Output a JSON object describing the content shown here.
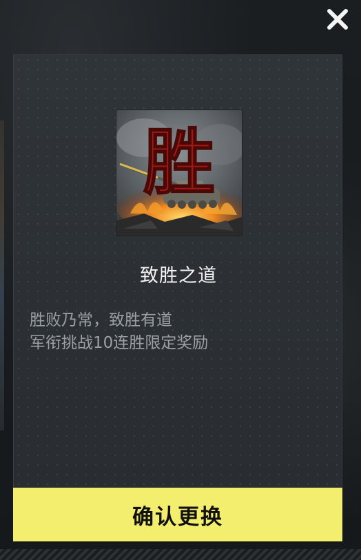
{
  "dialog": {
    "close_icon": "close-icon",
    "reward_icon": "victory-tank-badge-icon",
    "reward_glyph": "胜",
    "title": "致胜之道",
    "description_lines": [
      "胜败乃常，致胜有道",
      "军衔挑战10连胜限定奖励"
    ],
    "confirm_label": "确认更换"
  },
  "colors": {
    "panel": "#2b3034",
    "confirm_button": "#f4ee6e",
    "title_text": "#f2f2f2",
    "description_text": "#9aa0a4",
    "glyph_red": "#9e1a14"
  }
}
